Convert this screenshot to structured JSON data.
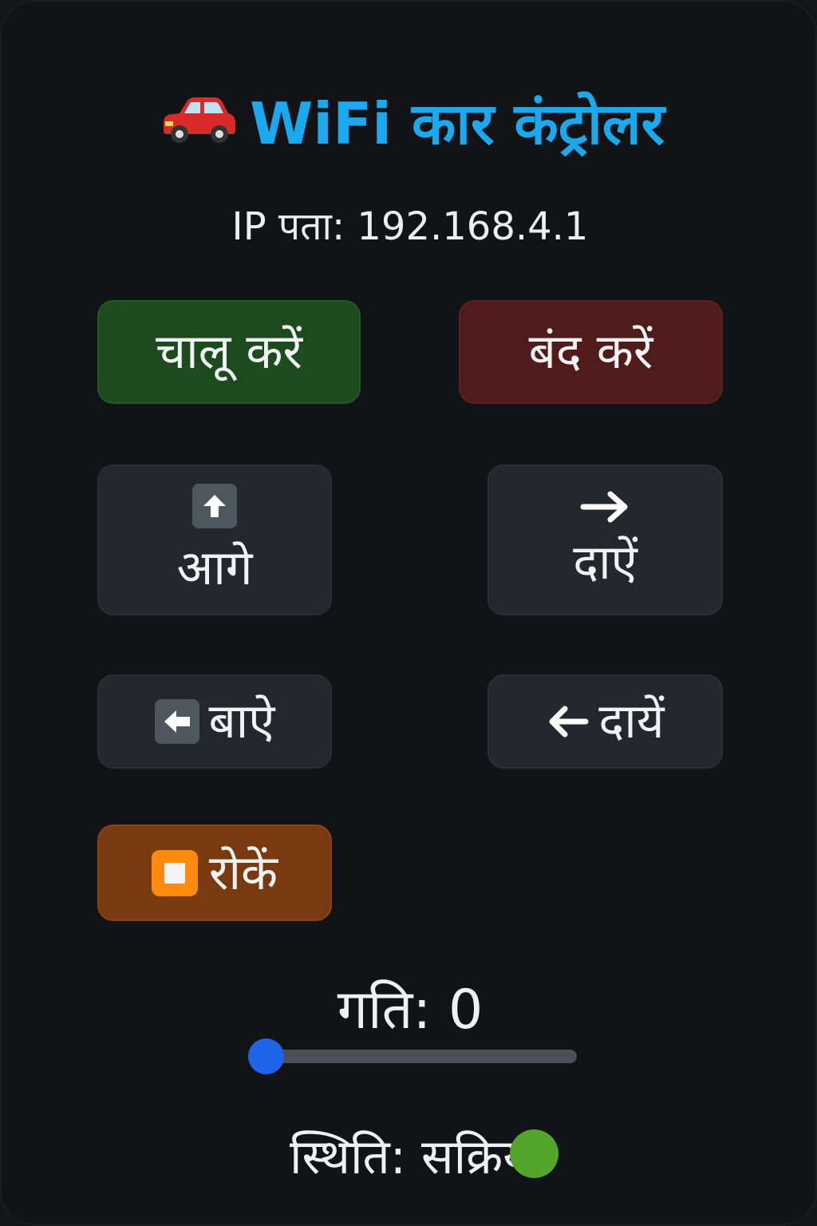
{
  "header": {
    "icon": "car-icon",
    "title": "WiFi कार कंट्रोलर",
    "accent_color": "#1aa9ee"
  },
  "connection": {
    "ip_text": "IP पता: 192.168.4.1"
  },
  "power": {
    "on_label": "चालू करें",
    "off_label": "बंद करें",
    "on_color": "#1d4a1f",
    "off_color": "#521b1b"
  },
  "controls": {
    "forward": {
      "icon": "up-arrow-icon",
      "label": "आगे"
    },
    "right": {
      "icon": "right-arrow-icon",
      "label": "दाऐं"
    },
    "left": {
      "icon": "left-arrow-box-icon",
      "label": "बाऐ"
    },
    "left_alt": {
      "icon": "left-arrow-icon",
      "label": "दायें"
    },
    "stop": {
      "icon": "stop-icon",
      "label": "रोकें",
      "color": "#7a3a10"
    }
  },
  "speed": {
    "label": "गति: 0",
    "value": 0,
    "thumb_color": "#1f63e8"
  },
  "status": {
    "text": "स्थिति: सक्रिय",
    "indicator_color": "#52a72a"
  }
}
